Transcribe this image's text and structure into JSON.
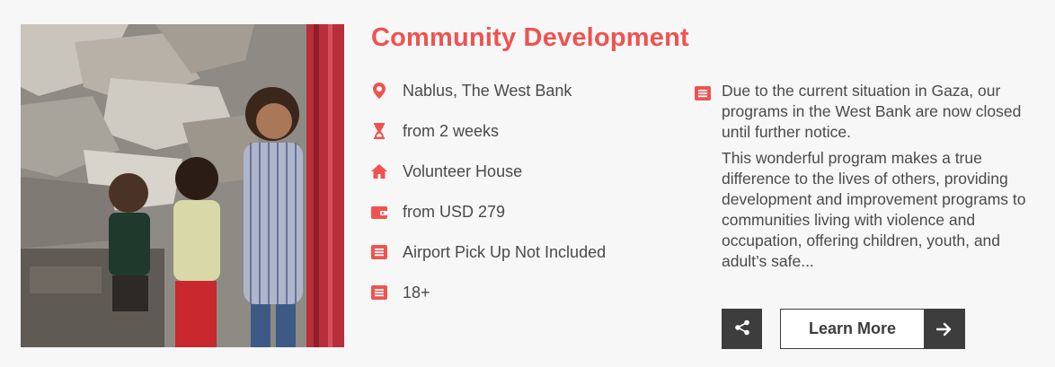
{
  "program": {
    "title": "Community Development",
    "photo_alt": "Children standing in front of rubble",
    "facts": [
      {
        "icon": "location-pin-icon",
        "text": "Nablus, The West Bank"
      },
      {
        "icon": "hourglass-icon",
        "text": "from 2 weeks"
      },
      {
        "icon": "house-icon",
        "text": "Volunteer House"
      },
      {
        "icon": "wallet-icon",
        "text": "from USD 279"
      },
      {
        "icon": "list-icon",
        "text": "Airport Pick Up Not Included"
      },
      {
        "icon": "list-icon",
        "text": "18+"
      }
    ],
    "description": {
      "icon": "list-icon",
      "notice": "Due to the current situation in Gaza, our programs in the West Bank are now closed until further notice.",
      "summary": "This wonderful program makes a true difference to the lives of others, providing development and improvement programs to communities living with violence and occupation, offering children, youth, and adult’s safe..."
    },
    "actions": {
      "share_icon": "share-icon",
      "learn_more": "Learn More",
      "learn_more_icon": "arrow-right-icon"
    }
  },
  "colors": {
    "accent": "#ef5350",
    "dark_button": "#3d3d3d",
    "background": "#f7f7f7",
    "text": "#4a4a4a"
  }
}
